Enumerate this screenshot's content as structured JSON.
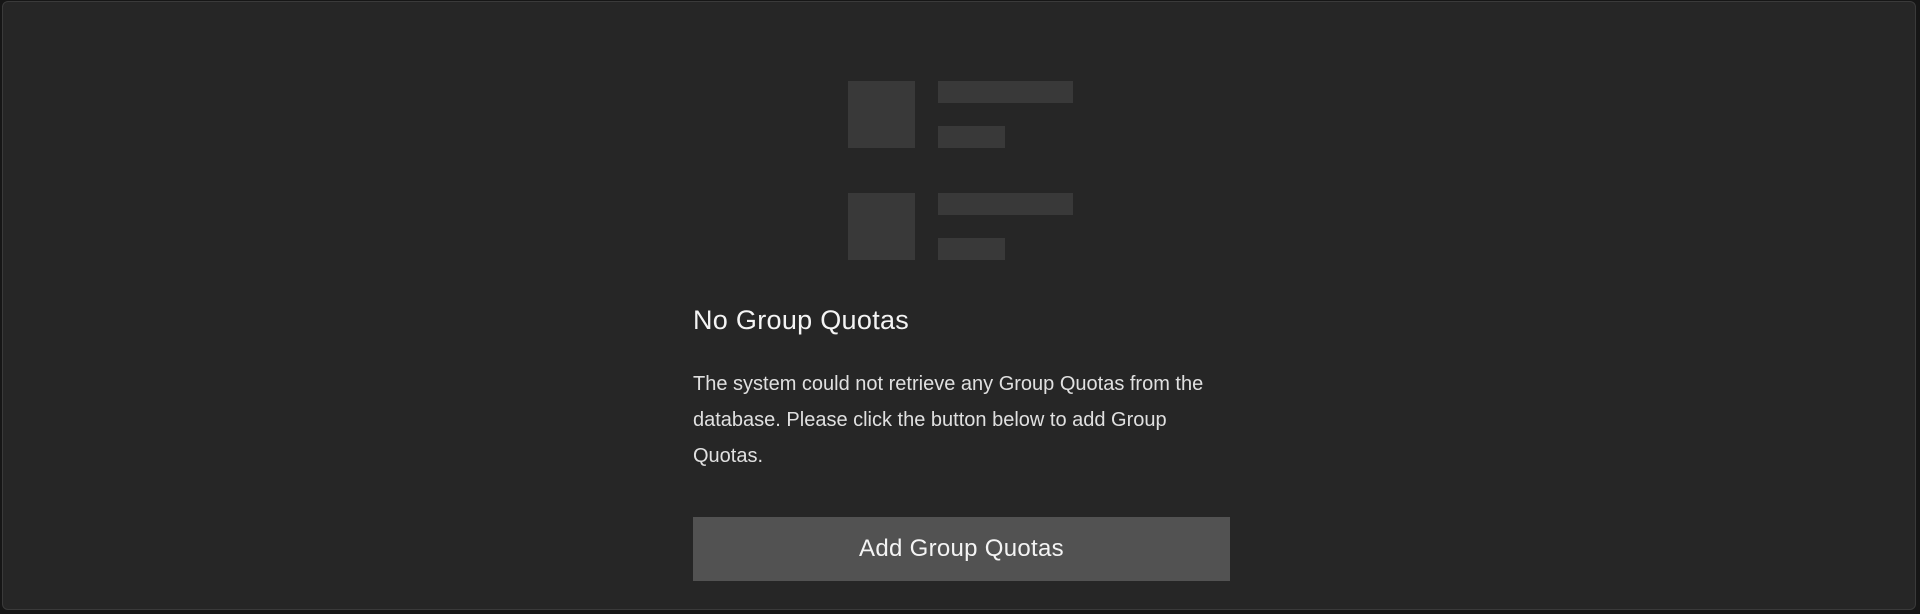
{
  "empty_state": {
    "title": "No Group Quotas",
    "description": "The system could not retrieve any Group Quotas from the database. Please click the button below to add Group Quotas.",
    "button_label": "Add Group Quotas"
  },
  "colors": {
    "page_background": "#161616",
    "panel_background": "#262626",
    "illustration": "#393939",
    "button_background": "#525252",
    "text_primary": "#f4f4f4"
  }
}
